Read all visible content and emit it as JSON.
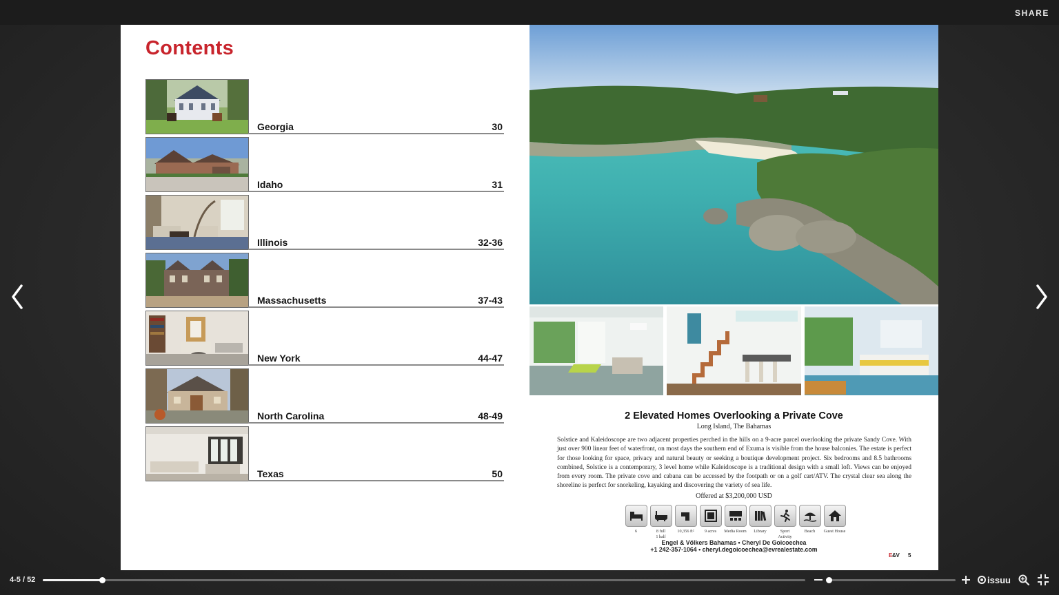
{
  "topbar": {
    "share_label": "SHARE"
  },
  "navigation": {
    "prev_icon": "chevron-left-icon",
    "next_icon": "chevron-right-icon"
  },
  "left_page": {
    "title": "Contents",
    "items": [
      {
        "label": "Georgia",
        "pages": "30"
      },
      {
        "label": "Idaho",
        "pages": "31"
      },
      {
        "label": "Illinois",
        "pages": "32-36"
      },
      {
        "label": "Massachusetts",
        "pages": "37-43"
      },
      {
        "label": "New York",
        "pages": "44-47"
      },
      {
        "label": "North Carolina",
        "pages": "48-49"
      },
      {
        "label": "Texas",
        "pages": "50"
      }
    ]
  },
  "right_page": {
    "title": "2 Elevated Homes Overlooking a Private Cove",
    "location": "Long Island, The Bahamas",
    "description": "Solstice and Kaleidoscope are two adjacent properties perched in the hills on a 9-acre parcel overlooking the private Sandy Cove. With just over 900 linear feet of waterfront, on most days the southern end of Exuma is visible from the house balconies. The estate is perfect for those looking for space, privacy and natural beauty or seeking a boutique development project. Six bedrooms and 8.5 bathrooms combined, Solstice is a contemporary, 3 level home while Kaleidoscope is a traditional design with a small loft. Views can be enjoyed from every room. The private cove and cabana can be accessed by the footpath or on a golf cart/ATV. The crystal clear sea along the shoreline is perfect for snorkeling, kayaking and discovering the variety of sea life.",
    "price": "Offered at $3,200,000 USD",
    "amenities": [
      {
        "icon": "bed-icon",
        "label": "6"
      },
      {
        "icon": "bathtub-icon",
        "label": "8 full\n1 half"
      },
      {
        "icon": "floor-area-icon",
        "label": "10,356 ft²"
      },
      {
        "icon": "lot-size-icon",
        "label": "9 acres"
      },
      {
        "icon": "media-room-icon",
        "label": "Media Room"
      },
      {
        "icon": "library-icon",
        "label": "Library"
      },
      {
        "icon": "sport-activity-icon",
        "label": "Sport Activity"
      },
      {
        "icon": "beach-icon",
        "label": "Beach"
      },
      {
        "icon": "guest-house-icon",
        "label": "Guest House"
      }
    ],
    "agent_line": "Engel & Völkers Bahamas • Cheryl De Goicoechea",
    "contact_line": "+1 242-357-1064 • cheryl.degoicoechea@evrealestate.com",
    "brand": {
      "e": "E",
      "amp": "&",
      "v": "V"
    },
    "page_number": "5"
  },
  "bottom_bar": {
    "page_indicator": "4-5 / 52",
    "progress": 0.078,
    "zoom_level": 0.01,
    "brand": "issuu"
  },
  "colors": {
    "accent_red": "#c8242c",
    "bar_dark": "#1c1c1c",
    "page_white": "#ffffff"
  }
}
